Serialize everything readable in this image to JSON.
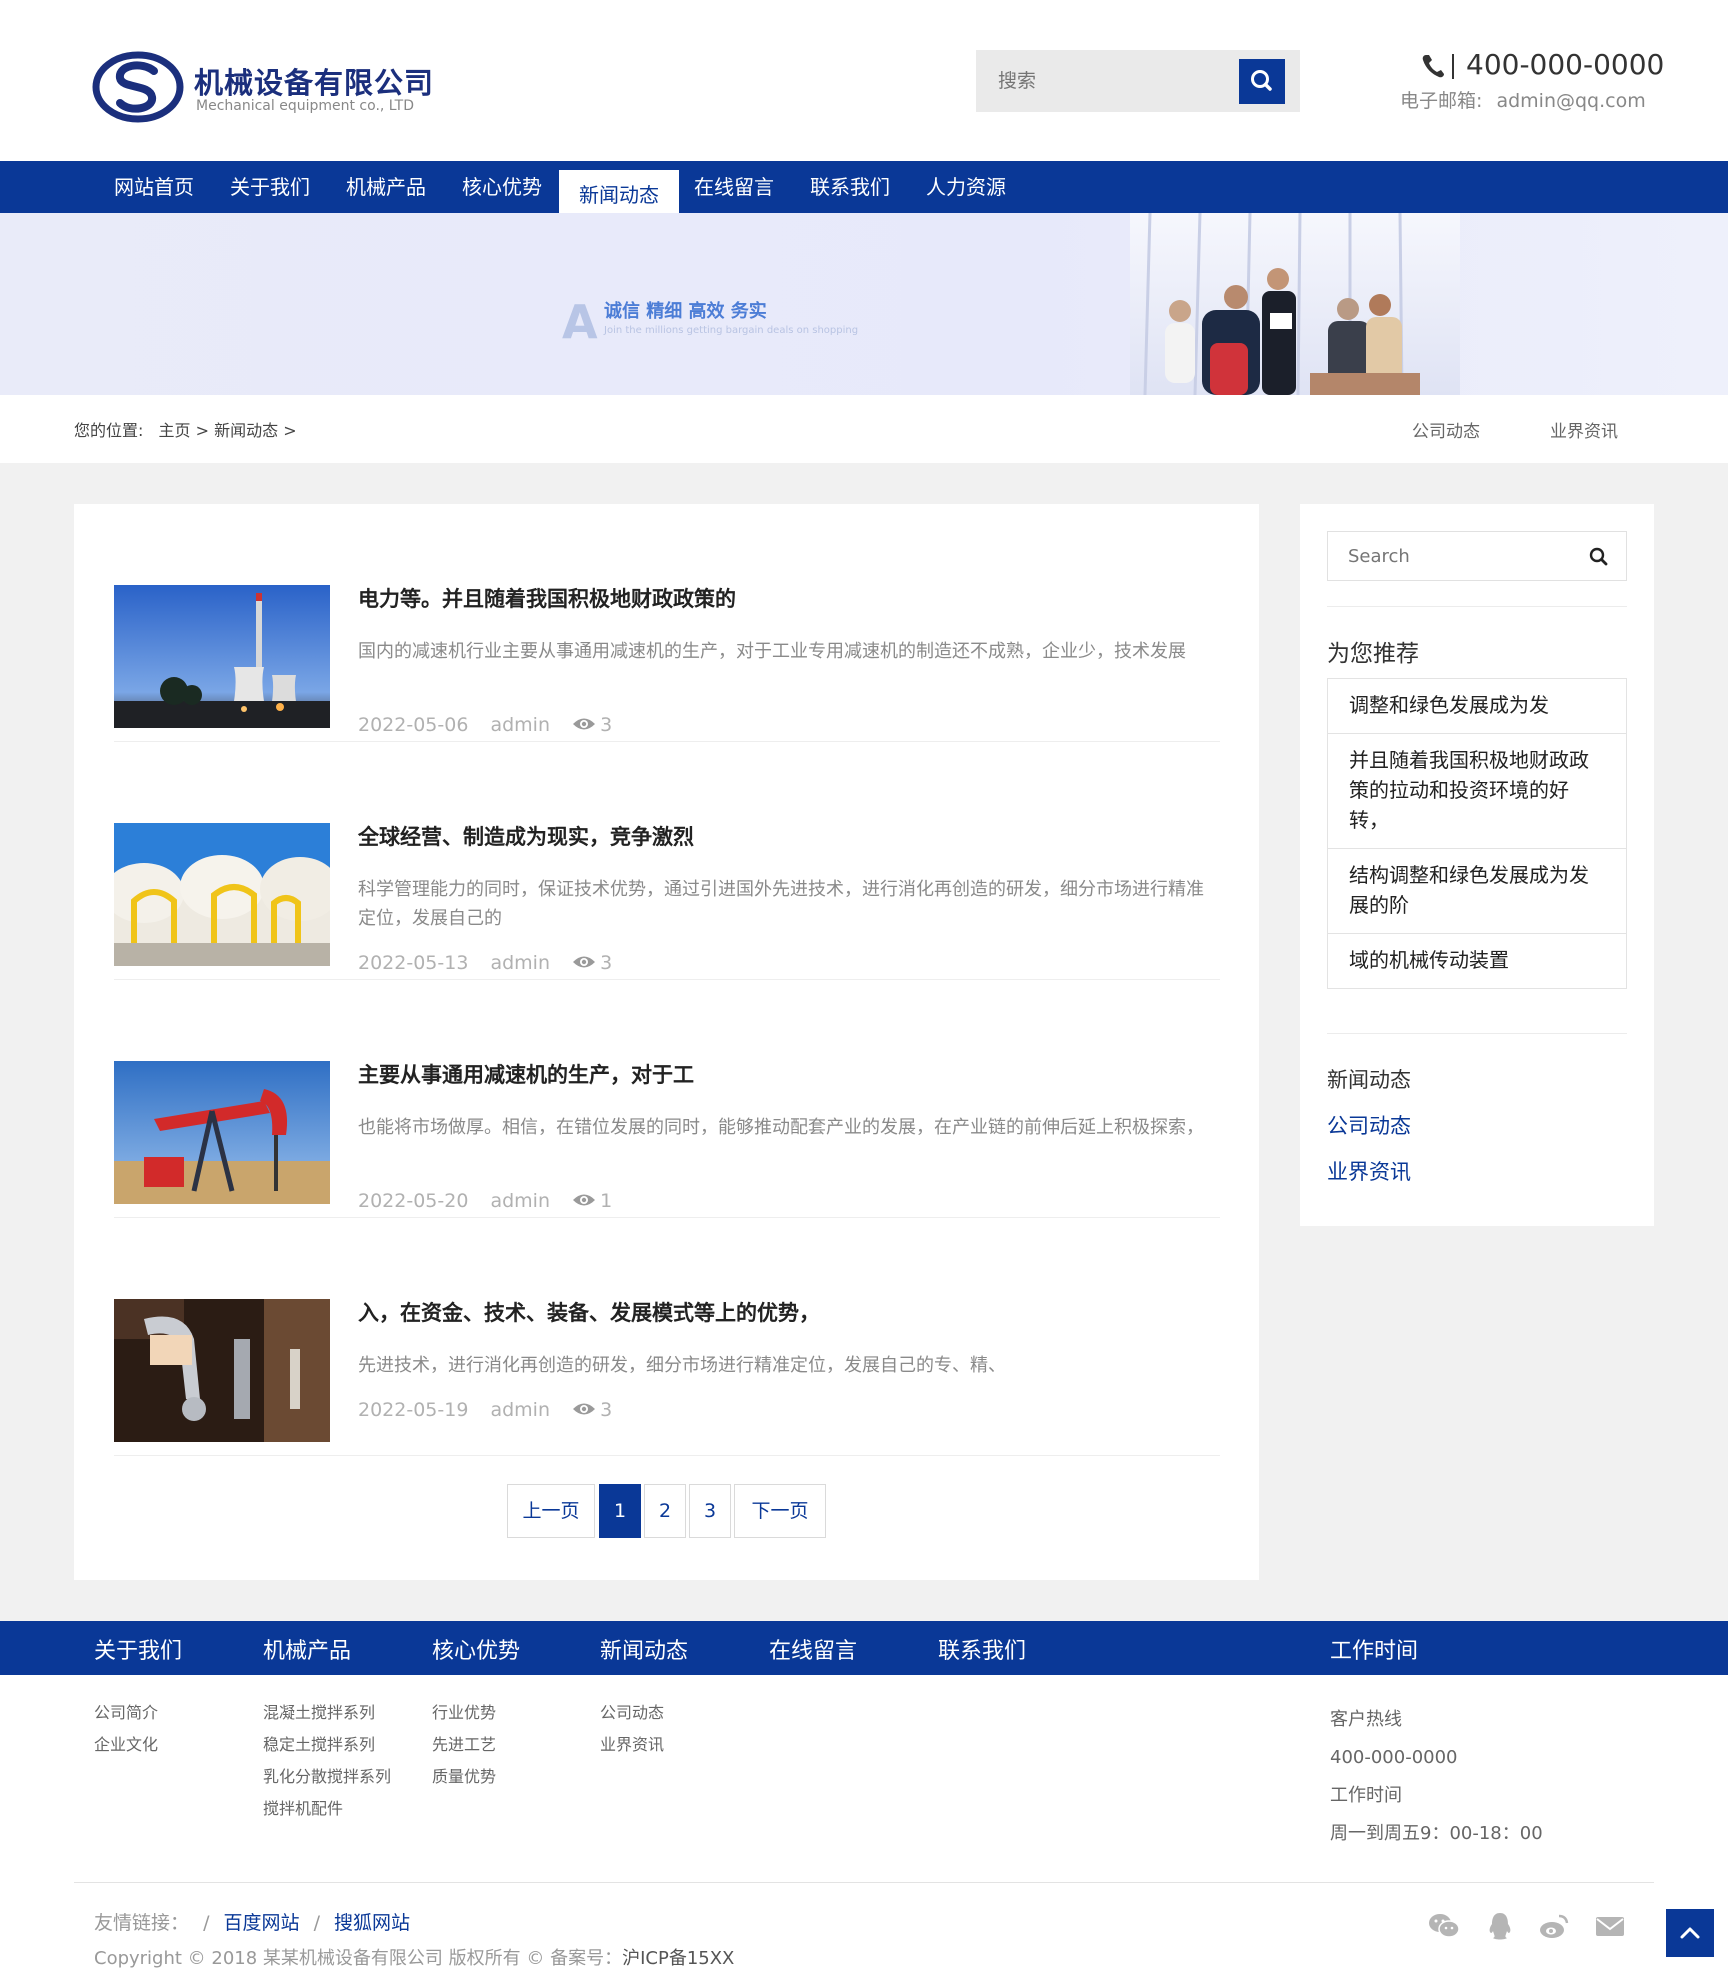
{
  "header": {
    "company_name": "机械设备有限公司",
    "company_sub": "Mechanical equipment co., LTD",
    "search_placeholder": "搜索",
    "phone": "400-000-0000",
    "email_label": "电子邮箱:",
    "email": "admin@qq.com"
  },
  "nav": {
    "items": [
      "网站首页",
      "关于我们",
      "机械产品",
      "核心优势",
      "新闻动态",
      "在线留言",
      "联系我们",
      "人力资源"
    ],
    "active_index": 4
  },
  "banner": {
    "letter": "A",
    "slogan": "诚信 精细 高效 务实",
    "subline": "Join the millions getting bargain deals on shopping"
  },
  "breadcrumb": {
    "label": "您的位置:",
    "home": "主页",
    "sep": ">",
    "current": "新闻动态",
    "right_links": [
      "公司动态",
      "业界资讯"
    ]
  },
  "articles": [
    {
      "title": "电力等。并且随着我国积极地财政政策的",
      "desc": "国内的减速机行业主要从事通用减速机的生产，对于工业专用减速机的制造还不成熟，企业少，技术发展",
      "date": "2022-05-06",
      "author": "admin",
      "views": "3"
    },
    {
      "title": "全球经营、制造成为现实，竞争激烈",
      "desc": "科学管理能力的同时，保证技术优势，通过引进国外先进技术，进行消化再创造的研发，细分市场进行精准定位，发展自己的",
      "date": "2022-05-13",
      "author": "admin",
      "views": "3"
    },
    {
      "title": "主要从事通用减速机的生产，对于工",
      "desc": "也能将市场做厚。相信，在错位发展的同时，能够推动配套产业的发展，在产业链的前伸后延上积极探索，",
      "date": "2022-05-20",
      "author": "admin",
      "views": "1"
    },
    {
      "title": "入，在资金、技术、装备、发展模式等上的优势，",
      "desc": "先进技术，进行消化再创造的研发，细分市场进行精准定位，发展自己的专、精、",
      "date": "2022-05-19",
      "author": "admin",
      "views": "3"
    }
  ],
  "pagination": {
    "prev": "上一页",
    "pages": [
      "1",
      "2",
      "3"
    ],
    "active": "1",
    "next": "下一页"
  },
  "sidebar": {
    "search_placeholder": "Search",
    "recommend_title": "为您推荐",
    "recommend": [
      "调整和绿色发展成为发",
      "并且随着我国积极地财政政策的拉动和投资环境的好转，",
      "结构调整和绿色发展成为发展的阶",
      "域的机械传动装置"
    ],
    "categories": [
      "新闻动态",
      "公司动态",
      "业界资讯"
    ]
  },
  "footer": {
    "headings": [
      "关于我们",
      "机械产品",
      "核心优势",
      "新闻动态",
      "在线留言",
      "联系我们",
      "工作时间"
    ],
    "col_about": [
      "公司简介",
      "企业文化"
    ],
    "col_products": [
      "混凝土搅拌系列",
      "稳定土搅拌系列",
      "乳化分散搅拌系列",
      "搅拌机配件"
    ],
    "col_advantage": [
      "行业优势",
      "先进工艺",
      "质量优势"
    ],
    "col_news": [
      "公司动态",
      "业界资讯"
    ],
    "contact": [
      "客户热线",
      "400-000-0000",
      "工作时间",
      "周一到周五9：00-18：00"
    ],
    "links_label": "友情链接：",
    "links": [
      "百度网站",
      "搜狐网站"
    ],
    "link_sep": "/",
    "copyright": "Copyright © 2018 某某机械设备有限公司 版权所有 © 备案号：",
    "icp": "沪ICP备15XX"
  },
  "colors": {
    "brand_blue": "#0a3897",
    "logo_blue": "#1b2f7d",
    "banner_slogan": "#4c7dd6"
  },
  "icons": [
    "logo-mark",
    "search-icon",
    "phone-icon",
    "eye-icon",
    "wechat-icon",
    "qq-icon",
    "weibo-icon",
    "mail-icon",
    "arrow-up-icon"
  ]
}
